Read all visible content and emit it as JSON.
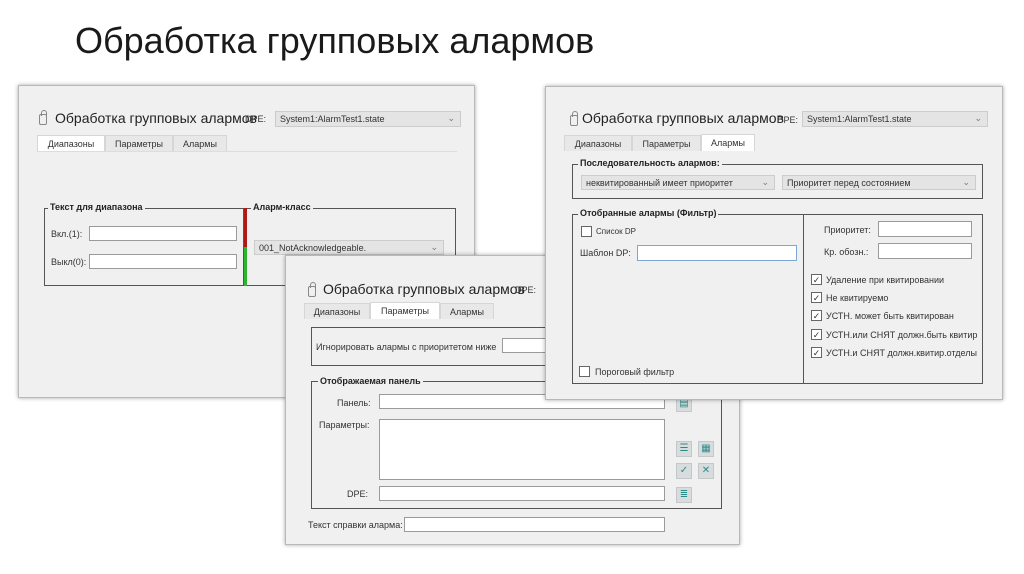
{
  "slide_title": "Обработка групповых алармов",
  "dialog_title": "Обработка групповых алармов",
  "dpe_label": "DPE:",
  "dpe_value": "System1:AlarmTest1.state",
  "tabs": [
    "Диапазоны",
    "Параметры",
    "Алармы"
  ],
  "ranges": {
    "group_text": "Текст для диапазона",
    "on_label": "Вкл.(1):",
    "off_label": "Выкл(0):",
    "alarm_class_title": "Аларм-класс",
    "alarm_class_value": "001_NotAcknowledgeable.",
    "colors": {
      "on": "#b01818",
      "off": "#2db52d"
    }
  },
  "params": {
    "ignore_label": "Игнорировать алармы с приоритетом ниже",
    "panel_group": "Отображаемая панель",
    "panel_label": "Панель:",
    "params_label": "Параметры:",
    "dpe_label": "DPE:",
    "help_label": "Текст справки аларма:"
  },
  "alarms": {
    "sequence_group": "Последовательность алармов:",
    "sequence_value1": "неквитированный имеет приоритет",
    "sequence_value2": "Приоритет перед состоянием",
    "filter_group": "Отобранные алармы (Фильтр)",
    "dp_list": "Список DP",
    "dp_pattern": "Шаблон DP:",
    "priority": "Приоритет:",
    "short_sign": "Кр. обозн.:",
    "threshold": "Пороговый фильтр",
    "checks": [
      "Удаление при квитировании",
      "Не квитируемо",
      "УСТН. может быть квитирован",
      "УСТН.или СНЯТ должн.быть квитир",
      "УСТН.и СНЯТ должн.квитир.отделы"
    ]
  }
}
